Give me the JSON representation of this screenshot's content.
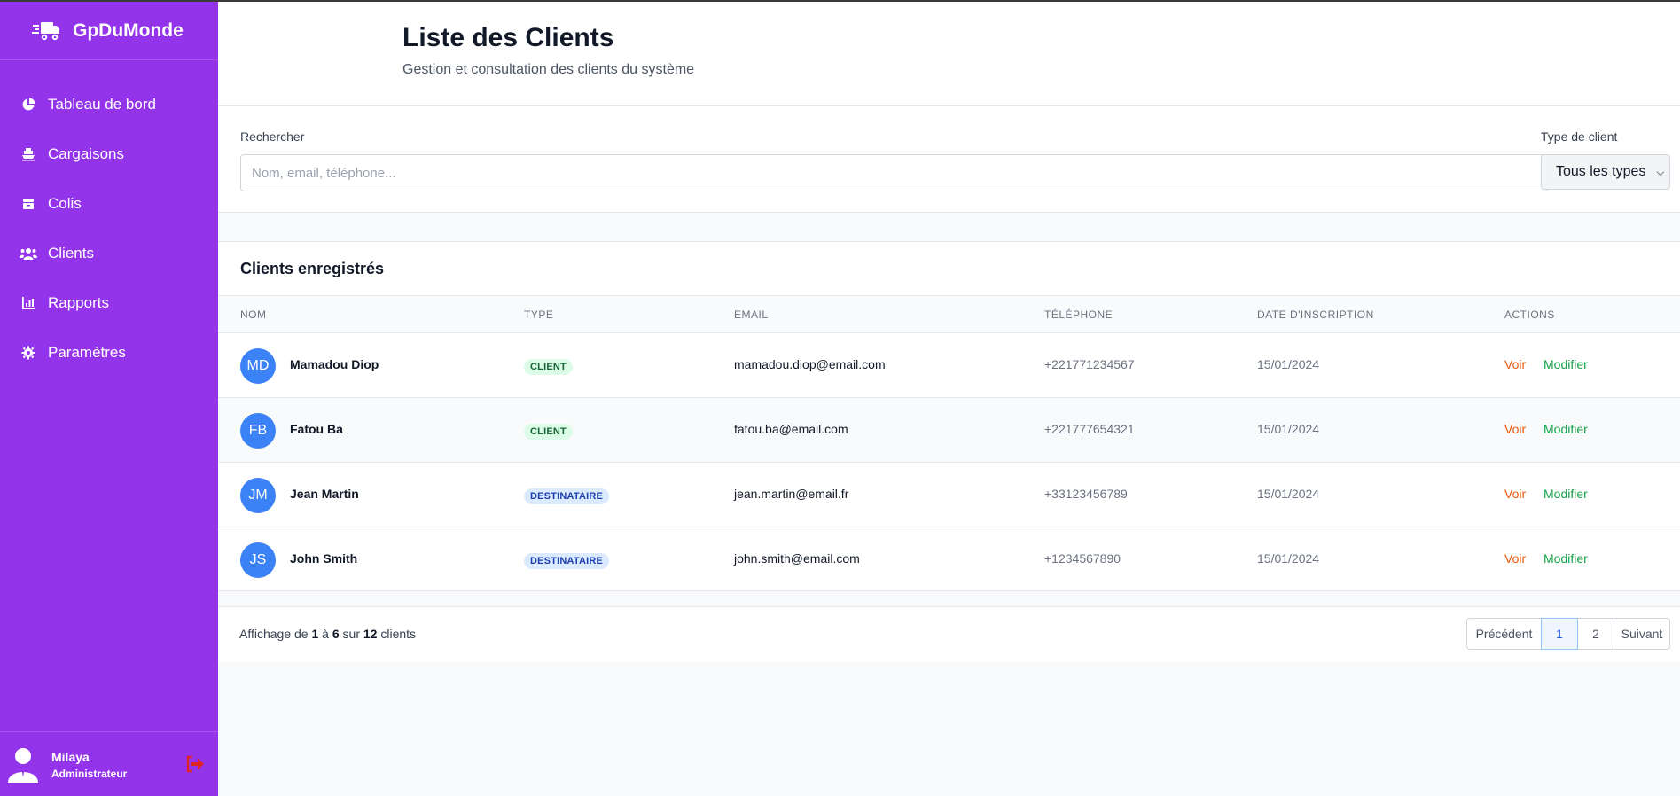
{
  "brand": {
    "name": "GpDuMonde",
    "icon": "truck-icon"
  },
  "nav": [
    {
      "label": "Tableau de bord",
      "icon": "chart-pie-icon"
    },
    {
      "label": "Cargaisons",
      "icon": "ship-icon"
    },
    {
      "label": "Colis",
      "icon": "box-icon"
    },
    {
      "label": "Clients",
      "icon": "users-icon"
    },
    {
      "label": "Rapports",
      "icon": "chart-bar-icon"
    },
    {
      "label": "Paramètres",
      "icon": "gear-icon"
    }
  ],
  "user": {
    "name": "Milaya",
    "role": "Administrateur"
  },
  "header": {
    "title": "Liste des Clients",
    "subtitle": "Gestion et consultation des clients du système"
  },
  "filters": {
    "search_label": "Rechercher",
    "search_placeholder": "Nom, email, téléphone...",
    "search_value": "",
    "type_label": "Type de client",
    "type_selected": "Tous les types"
  },
  "table": {
    "title": "Clients enregistrés",
    "columns": [
      "NOM",
      "TYPE",
      "EMAIL",
      "TÉLÉPHONE",
      "DATE D'INSCRIPTION",
      "ACTIONS"
    ],
    "action_view": "Voir",
    "action_edit": "Modifier",
    "rows": [
      {
        "initials": "MD",
        "name": "Mamadou Diop",
        "type": "CLIENT",
        "email": "mamadou.diop@email.com",
        "phone": "+221771234567",
        "date": "15/01/2024"
      },
      {
        "initials": "FB",
        "name": "Fatou Ba",
        "type": "CLIENT",
        "email": "fatou.ba@email.com",
        "phone": "+221777654321",
        "date": "15/01/2024"
      },
      {
        "initials": "JM",
        "name": "Jean Martin",
        "type": "DESTINATAIRE",
        "email": "jean.martin@email.fr",
        "phone": "+33123456789",
        "date": "15/01/2024"
      },
      {
        "initials": "JS",
        "name": "John Smith",
        "type": "DESTINATAIRE",
        "email": "john.smith@email.com",
        "phone": "+1234567890",
        "date": "15/01/2024"
      }
    ]
  },
  "pagination": {
    "prefix": "Affichage de",
    "from": "1",
    "word_to": "à",
    "to": "6",
    "word_of": "sur",
    "total": "12",
    "suffix": "clients",
    "prev": "Précédent",
    "page1": "1",
    "page2": "2",
    "next": "Suivant"
  },
  "colors": {
    "sidebar": "#9333ea",
    "avatar": "#3b82f6",
    "view": "#ea580c",
    "edit": "#16a34a"
  }
}
